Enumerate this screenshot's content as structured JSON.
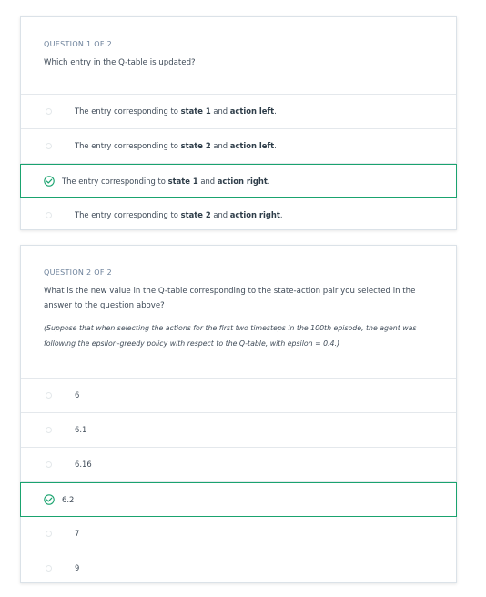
{
  "q1": {
    "label": "QUESTION 1 OF 2",
    "text": "Which entry in the Q-table is updated?",
    "options": [
      {
        "prefix": "The entry corresponding to ",
        "state": "state 1",
        "mid": " and ",
        "action": "action left",
        "suffix": "."
      },
      {
        "prefix": "The entry corresponding to ",
        "state": "state 2",
        "mid": " and ",
        "action": "action left",
        "suffix": "."
      },
      {
        "prefix": "The entry corresponding to ",
        "state": "state 1",
        "mid": " and ",
        "action": "action right",
        "suffix": "."
      },
      {
        "prefix": "The entry corresponding to ",
        "state": "state 2",
        "mid": " and ",
        "action": "action right",
        "suffix": "."
      }
    ]
  },
  "q2": {
    "label": "QUESTION 2 OF 2",
    "text": "What is the new value in the Q-table corresponding to the state-action pair you selected in the answer to the question above?",
    "note": "(Suppose that when selecting the actions for the first two timesteps in the 100th episode, the agent was following the epsilon-greedy policy with respect to the Q-table, with epsilon = 0.4.)",
    "options": [
      "6",
      "6.1",
      "6.16",
      "6.2",
      "7",
      "9"
    ]
  },
  "colors": {
    "correct": "#1aa36f",
    "border": "#dbe2e8"
  }
}
